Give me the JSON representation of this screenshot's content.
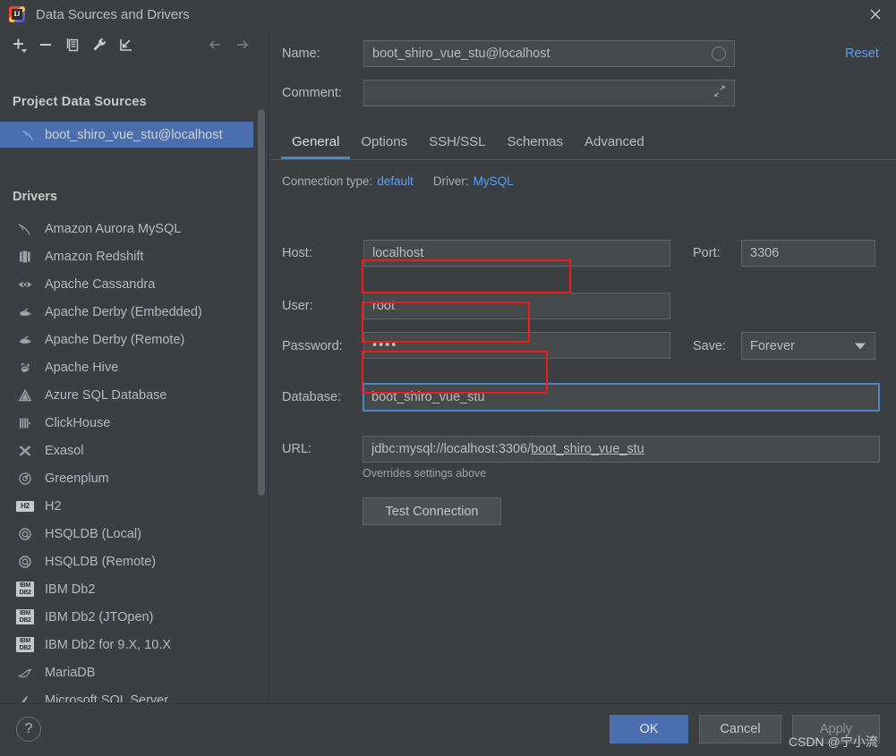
{
  "window": {
    "title": "Data Sources and Drivers",
    "app_icon": "intellij-idea-icon",
    "close_icon": "close-icon"
  },
  "left_panel": {
    "toolbar": [
      {
        "name": "add-button",
        "icon": "plus-icon"
      },
      {
        "name": "remove-button",
        "icon": "minus-icon"
      },
      {
        "name": "copy-button",
        "icon": "copy-icon"
      },
      {
        "name": "properties-button",
        "icon": "wrench-icon"
      },
      {
        "name": "import-button",
        "icon": "import-arrow-icon"
      },
      {
        "name": "back-button",
        "icon": "arrow-left-icon"
      },
      {
        "name": "forward-button",
        "icon": "arrow-right-icon"
      }
    ],
    "project_sources_title": "Project Data Sources",
    "selected_data_source": {
      "label": "boot_shiro_vue_stu@localhost",
      "icon": "mysql-dolphin-icon",
      "selected": true
    },
    "drivers_title": "Drivers",
    "drivers": [
      {
        "label": "Amazon Aurora MySQL",
        "icon": "mysql-dolphin-icon"
      },
      {
        "label": "Amazon Redshift",
        "icon": "redshift-icon"
      },
      {
        "label": "Apache Cassandra",
        "icon": "cassandra-eye-icon"
      },
      {
        "label": "Apache Derby (Embedded)",
        "icon": "derby-hat-icon"
      },
      {
        "label": "Apache Derby (Remote)",
        "icon": "derby-hat-icon"
      },
      {
        "label": "Apache Hive",
        "icon": "hive-bee-icon"
      },
      {
        "label": "Azure SQL Database",
        "icon": "azure-triangle-icon"
      },
      {
        "label": "ClickHouse",
        "icon": "clickhouse-bars-icon"
      },
      {
        "label": "Exasol",
        "icon": "exasol-x-icon"
      },
      {
        "label": "Greenplum",
        "icon": "greenplum-circle-icon"
      },
      {
        "label": "H2",
        "icon": "h2-badge-icon"
      },
      {
        "label": "HSQLDB (Local)",
        "icon": "hsqldb-icon"
      },
      {
        "label": "HSQLDB (Remote)",
        "icon": "hsqldb-icon"
      },
      {
        "label": "IBM Db2",
        "icon": "ibm-db2-badge-icon"
      },
      {
        "label": "IBM Db2 (JTOpen)",
        "icon": "ibm-db2-badge-icon"
      },
      {
        "label": "IBM Db2 for 9.X, 10.X",
        "icon": "ibm-db2-badge-icon"
      },
      {
        "label": "MariaDB",
        "icon": "mariadb-seal-icon"
      },
      {
        "label": "Microsoft SQL Server",
        "icon": "sqlserver-icon"
      }
    ],
    "scrollbar": "vertical-scrollbar"
  },
  "form": {
    "name_label": "Name:",
    "name_value": "boot_shiro_vue_stu@localhost",
    "comment_label": "Comment:",
    "comment_value": "",
    "comment_placeholder": "",
    "reset_label": "Reset",
    "tabs": [
      {
        "label": "General",
        "active": true
      },
      {
        "label": "Options",
        "active": false
      },
      {
        "label": "SSH/SSL",
        "active": false
      },
      {
        "label": "Schemas",
        "active": false
      },
      {
        "label": "Advanced",
        "active": false
      }
    ],
    "connection_type_label": "Connection type:",
    "connection_type_value": "default",
    "driver_label": "Driver:",
    "driver_value": "MySQL",
    "host_label": "Host:",
    "host_value": "localhost",
    "port_label": "Port:",
    "port_value": "3306",
    "user_label": "User:",
    "user_value": "root",
    "password_label": "Password:",
    "password_value": "••••",
    "save_label": "Save:",
    "save_value": "Forever",
    "database_label": "Database:",
    "database_value": "boot_shiro_vue_stu",
    "url_label": "URL:",
    "url_prefix": "jdbc:mysql://localhost:3306/",
    "url_database": "boot_shiro_vue_stu",
    "url_hint": "Overrides settings above",
    "test_connection_label": "Test Connection"
  },
  "annotations": [
    {
      "name": "highlight-user-field",
      "color": "#f01a1a"
    },
    {
      "name": "highlight-password-field",
      "color": "#f01a1a"
    },
    {
      "name": "highlight-database-field",
      "color": "#f01a1a"
    }
  ],
  "bottom_bar": {
    "help_label": "?",
    "ok_label": "OK",
    "cancel_label": "Cancel",
    "apply_label": "Apply"
  },
  "watermark": "CSDN @宁小流",
  "colors": {
    "accent_blue": "#4b6eaf",
    "link_blue": "#589df6",
    "focus_blue": "#4a88c7",
    "annotation_red": "#f01a1a",
    "window_bg": "#3c3f41",
    "field_bg": "#45494a"
  }
}
